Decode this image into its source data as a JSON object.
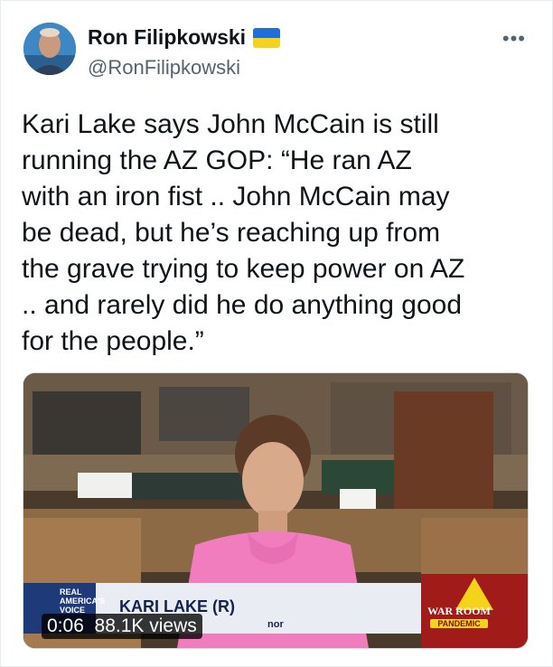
{
  "author": {
    "name": "Ron Filipkowski",
    "handle": "@RonFilipkowski"
  },
  "more_label": "•••",
  "tweet": {
    "text": "Kari Lake says John McCain is still\nrunning the AZ GOP: “He ran AZ\nwith an iron fist .. John McCain may\nbe dead, but he’s reaching up from\nthe grave trying to keep power on AZ\n.. and rarely did he do anything good\nfor the people.”"
  },
  "video": {
    "chyron_name": "KARI LAKE (R)",
    "chyron_sub": "nor",
    "network_logo": "REAL\nAMERICA'S\nVOICE",
    "show_logo": "WAR ROOM",
    "show_sub": "PANDEMIC",
    "overlay": "0:06  88.1K views"
  },
  "colors": {
    "flag_blue": "#1f6fd6",
    "flag_yellow": "#f5d31a",
    "handle_gray": "#536471"
  }
}
